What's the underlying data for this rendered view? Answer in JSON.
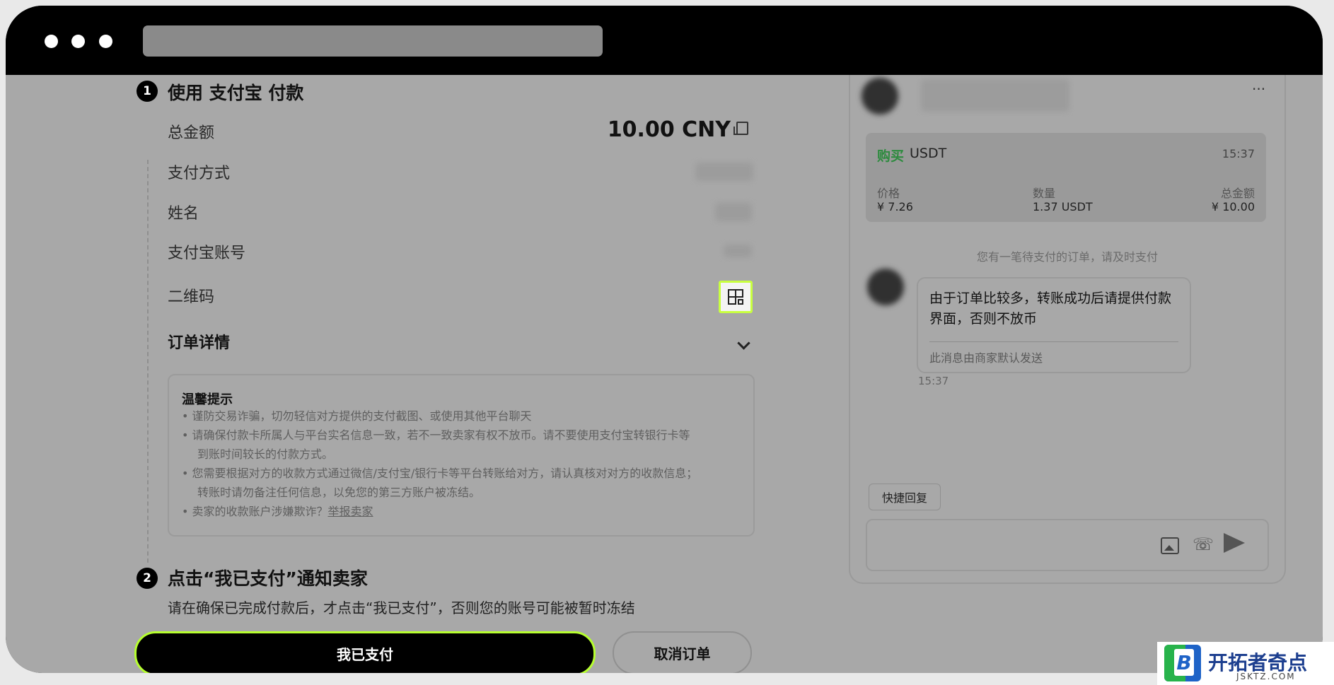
{
  "step1": {
    "number": "1",
    "title": "使用 支付宝 付款"
  },
  "payment": {
    "total_label": "总金额",
    "total_value": "10.00 CNY",
    "method_label": "支付方式",
    "name_label": "姓名",
    "account_label": "支付宝账号",
    "qr_label": "二维码",
    "details_label": "订单详情"
  },
  "tips": {
    "title": "温馨提示",
    "items": [
      "• 谨防交易诈骗，切勿轻信对方提供的支付截图、或使用其他平台聊天",
      "• 请确保付款卡所属人与平台实名信息一致，若不一致卖家有权不放币。请不要使用支付宝转银行卡等",
      "到账时间较长的付款方式。",
      "• 您需要根据对方的收款方式通过微信/支付宝/银行卡等平台转账给对方，请认真核对对方的收款信息；",
      "转账时请勿备注任何信息，以免您的第三方账户被冻结。",
      "• 卖家的收款账户涉嫌欺诈？"
    ],
    "report_link": "举报卖家"
  },
  "step2": {
    "number": "2",
    "title": "点击“我已支付”通知卖家",
    "note": "请在确保已完成付款后，才点击“我已支付”，否则您的账号可能被暂时冻结"
  },
  "buttons": {
    "paid": "我已支付",
    "cancel": "取消订单"
  },
  "chat": {
    "more": "···",
    "order": {
      "action": "购买",
      "coin": "USDT",
      "time": "15:37",
      "price_label": "价格",
      "price_value": "¥ 7.26",
      "qty_label": "数量",
      "qty_value": "1.37 USDT",
      "total_label": "总金额",
      "total_value": "¥ 10.00"
    },
    "system_msg": "您有一笔待支付的订单，请及时支付",
    "message_text": "由于订单比较多，转账成功后请提供付款界面，否则不放币",
    "message_note": "此消息由商家默认发送",
    "message_time": "15:37",
    "quick_reply": "快捷回复"
  },
  "watermark": {
    "name": "开拓者奇点",
    "url": "JSKTZ.COM",
    "mark": "B"
  },
  "colors": {
    "accent": "#b6ff2e",
    "buy_green": "#2e8b3f",
    "overlay": "#a8a8a8"
  },
  "icons": [
    "copy-icon",
    "qr-code-icon",
    "chevron-down-icon",
    "image-icon",
    "phone-icon",
    "send-icon",
    "more-icon"
  ]
}
